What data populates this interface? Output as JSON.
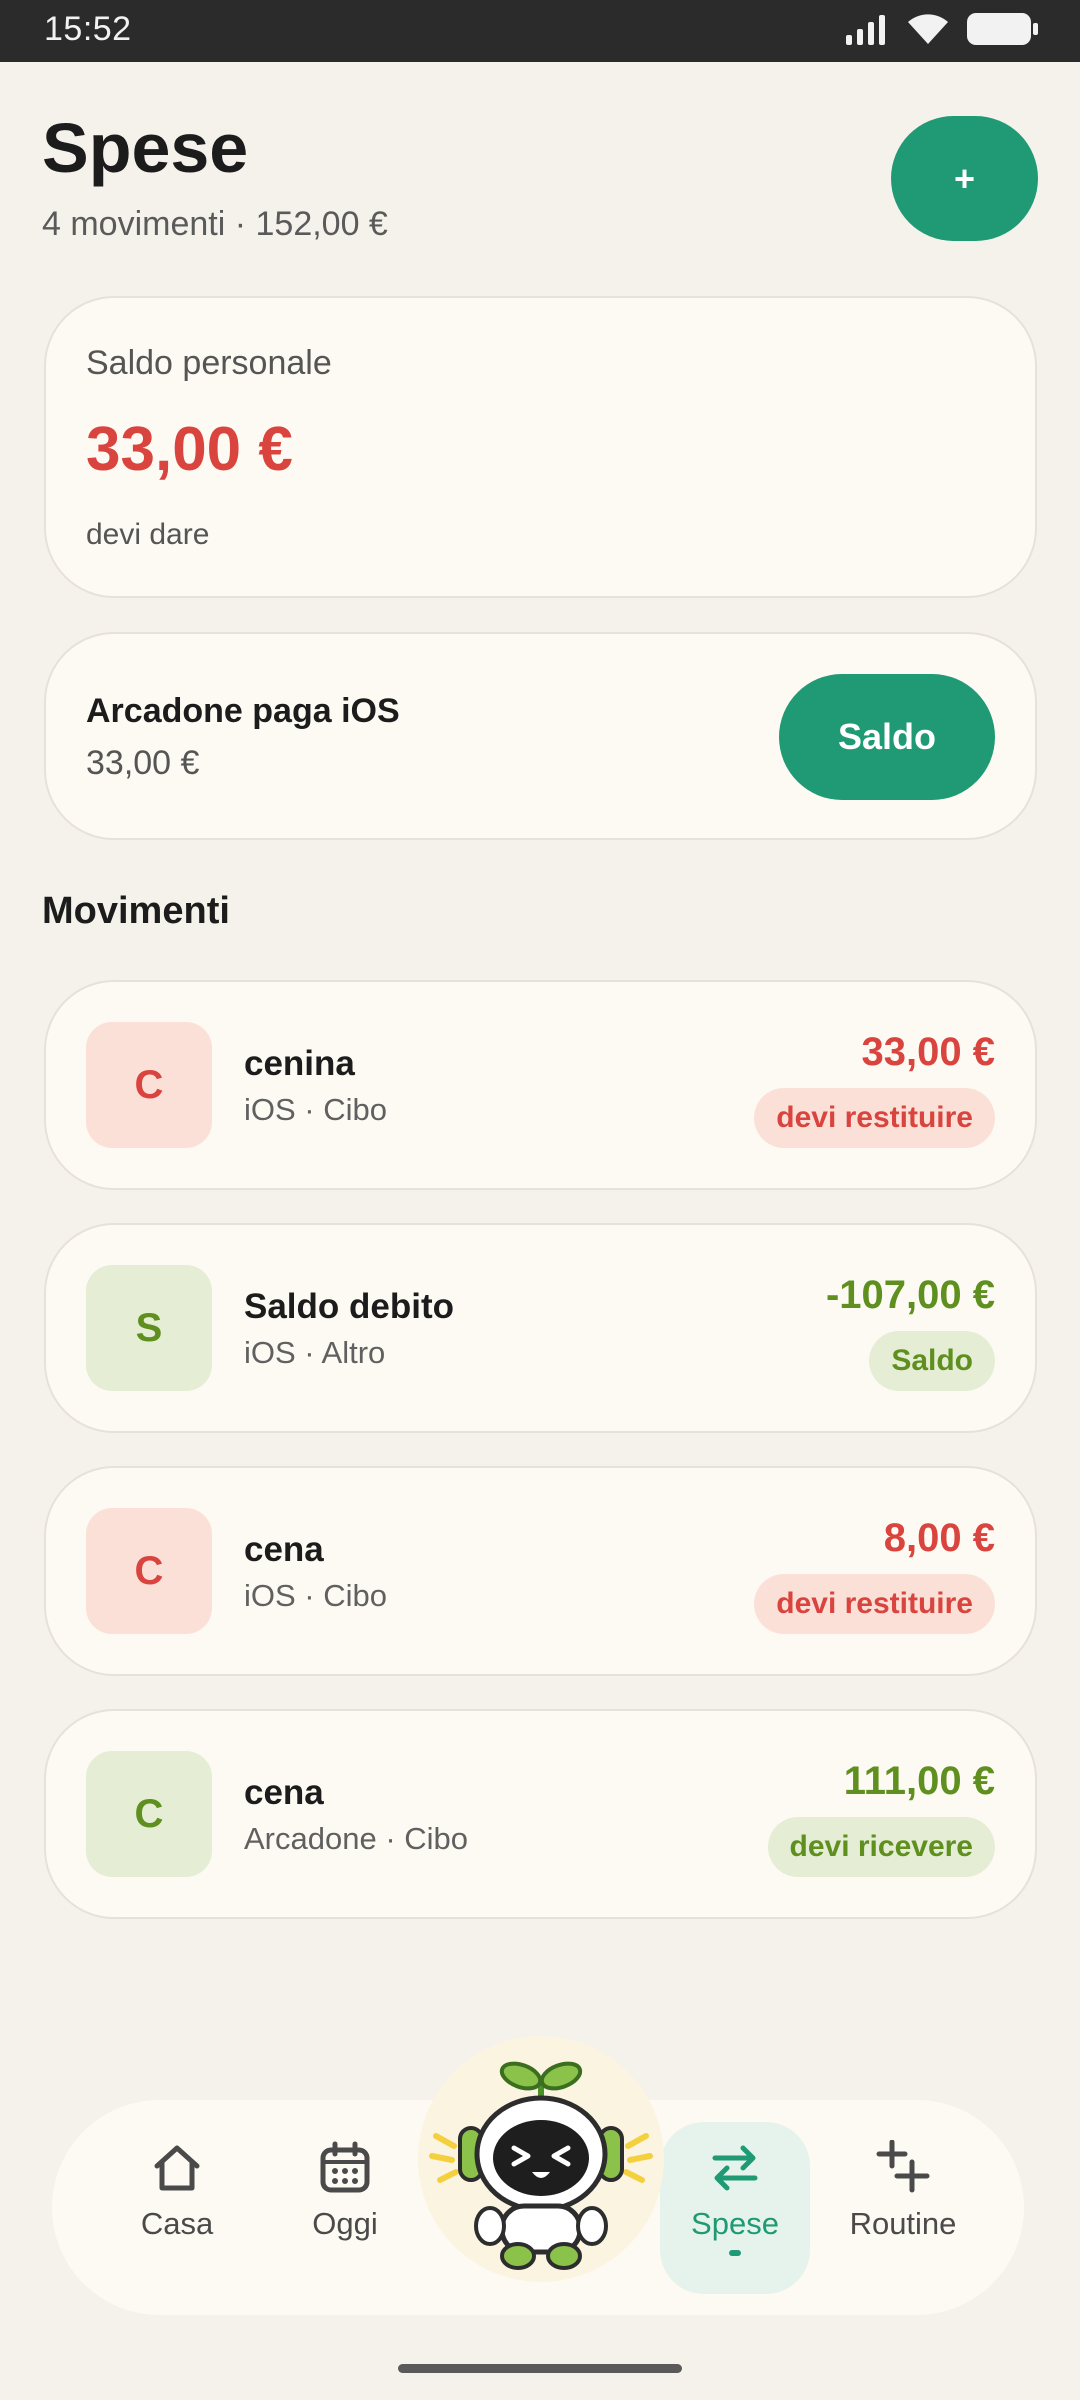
{
  "status": {
    "time": "15:52"
  },
  "header": {
    "title": "Spese",
    "subtitle": "4 movimenti · 152,00 €",
    "add_label": "+"
  },
  "balance": {
    "label": "Saldo personale",
    "amount": "33,00 €",
    "note": "devi dare"
  },
  "settlement": {
    "title": "Arcadone paga iOS",
    "amount": "33,00 €",
    "button_label": "Saldo"
  },
  "movements_title": "Movimenti",
  "transactions": [
    {
      "initial": "C",
      "title": "cenina",
      "sub": "iOS · Cibo",
      "amount": "33,00 €",
      "badge": "devi restituire",
      "tone": "red"
    },
    {
      "initial": "S",
      "title": "Saldo debito",
      "sub": "iOS · Altro",
      "amount": "-107,00 €",
      "badge": "Saldo",
      "tone": "green"
    },
    {
      "initial": "C",
      "title": "cena",
      "sub": "iOS · Cibo",
      "amount": "8,00 €",
      "badge": "devi restituire",
      "tone": "red"
    },
    {
      "initial": "C",
      "title": "cena",
      "sub": "Arcadone · Cibo",
      "amount": "111,00 €",
      "badge": "devi ricevere",
      "tone": "green"
    }
  ],
  "nav": {
    "items": [
      {
        "label": "Casa",
        "icon": "home-icon"
      },
      {
        "label": "Oggi",
        "icon": "calendar-icon"
      },
      {
        "label": "Spese",
        "icon": "swap-arrows-icon",
        "active": true
      },
      {
        "label": "Routine",
        "icon": "add-list-icon"
      }
    ],
    "mascot": "sprout-robot-mascot"
  },
  "colors": {
    "accent": "#1f9a74",
    "negative": "#d9443e",
    "positive": "#5e8f1f",
    "background": "#f5f2ec",
    "card": "#fdfaf3"
  }
}
